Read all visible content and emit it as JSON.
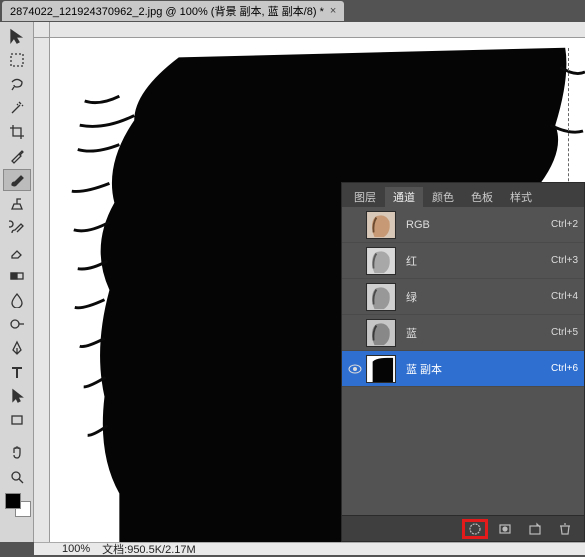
{
  "document": {
    "tab_title": "2874022_121924370962_2.jpg @ 100% (背景 副本, 蓝 副本/8) *",
    "close_glyph": "×"
  },
  "status": {
    "zoom": "100%",
    "doc_info": "文档:950.5K/2.17M"
  },
  "panel": {
    "tabs": {
      "layers": "图层",
      "channels": "通道",
      "color": "颜色",
      "swatches": "色板",
      "styles": "样式"
    },
    "active_tab": "channels",
    "channels": [
      {
        "label": "RGB",
        "shortcut": "Ctrl+2",
        "selected": false,
        "eye": false,
        "thumb": "color"
      },
      {
        "label": "红",
        "shortcut": "Ctrl+3",
        "selected": false,
        "eye": false,
        "thumb": "gray"
      },
      {
        "label": "绿",
        "shortcut": "Ctrl+4",
        "selected": false,
        "eye": false,
        "thumb": "gray"
      },
      {
        "label": "蓝",
        "shortcut": "Ctrl+5",
        "selected": false,
        "eye": false,
        "thumb": "gray"
      },
      {
        "label": "蓝 副本",
        "shortcut": "Ctrl+6",
        "selected": true,
        "eye": true,
        "thumb": "mask"
      }
    ]
  }
}
